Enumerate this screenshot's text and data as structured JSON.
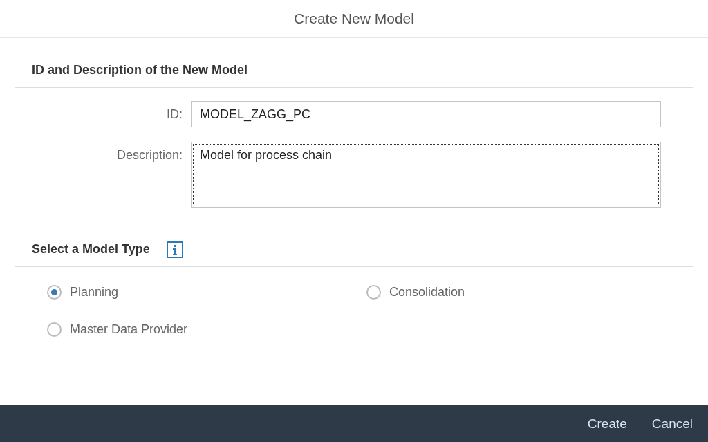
{
  "dialog": {
    "title": "Create New Model"
  },
  "id_section": {
    "title": "ID and Description of the New Model",
    "fields": [
      {
        "kind": "input",
        "label": "ID:",
        "value": "MODEL_ZAGG_PC",
        "focused": false
      },
      {
        "kind": "textarea",
        "label": "Description:",
        "value": "Model for process chain",
        "focused": true
      }
    ]
  },
  "type_section": {
    "title": "Select a Model Type",
    "options": [
      {
        "label": "Planning",
        "selected": true
      },
      {
        "label": "Consolidation",
        "selected": false
      },
      {
        "label": "Master Data Provider",
        "selected": false
      }
    ]
  },
  "footer": {
    "buttons": [
      "Create",
      "Cancel"
    ]
  }
}
